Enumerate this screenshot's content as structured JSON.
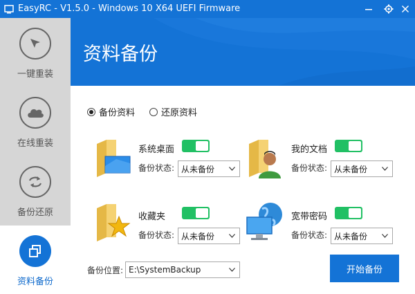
{
  "window": {
    "title": "EasyRC - V1.5.0 - Windows 10 X64 UEFI Firmware"
  },
  "sidebar": {
    "items": [
      {
        "label": "一键重装",
        "icon": "cursor-arrow-icon"
      },
      {
        "label": "在线重装",
        "icon": "cloud-icon"
      },
      {
        "label": "备份还原",
        "icon": "refresh-arrows-icon"
      },
      {
        "label": "资料备份",
        "icon": "copy-icon",
        "active": true
      }
    ]
  },
  "header": {
    "title": "资料备份"
  },
  "mode": {
    "backup_label": "备份资料",
    "restore_label": "还原资料",
    "selected": "backup"
  },
  "status_label": "备份状态:",
  "items": [
    {
      "name": "系统桌面",
      "icon": "desktop-folder-icon",
      "enabled": true,
      "status": "从未备份"
    },
    {
      "name": "我的文档",
      "icon": "documents-folder-icon",
      "enabled": true,
      "status": "从未备份"
    },
    {
      "name": "收藏夹",
      "icon": "favorites-folder-icon",
      "enabled": true,
      "status": "从未备份"
    },
    {
      "name": "宽带密码",
      "icon": "network-globe-icon",
      "enabled": true,
      "status": "从未备份"
    }
  ],
  "location": {
    "label": "备份位置:",
    "value": "E:\\SystemBackup"
  },
  "start_button": "开始备份",
  "colors": {
    "brand_blue": "#1473d6",
    "toggle_green": "#21c064",
    "sidebar_gray": "#d6d6d6"
  }
}
